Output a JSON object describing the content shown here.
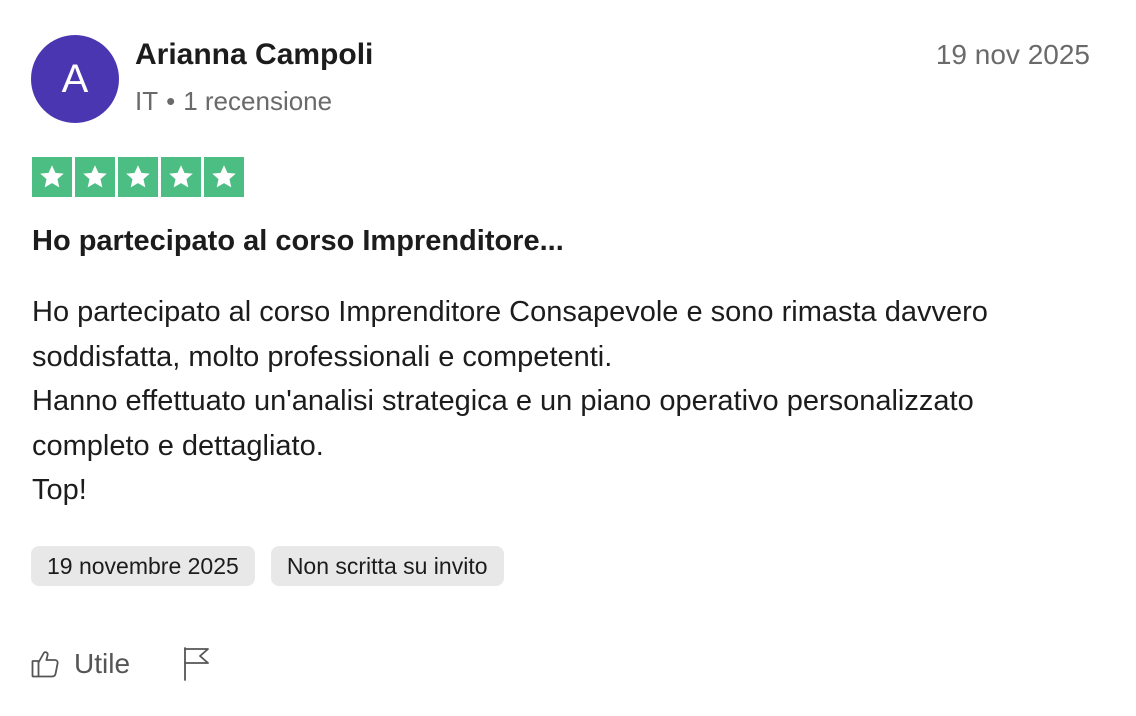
{
  "reviewer": {
    "initial": "A",
    "name": "Arianna Campoli",
    "country": "IT",
    "separator": "•",
    "review_count": "1 recensione",
    "avatar_color": "#4b36b1"
  },
  "review": {
    "date_short": "19 nov 2025",
    "rating": 5,
    "max_rating": 5,
    "star_color": "#4cbe84",
    "title": "Ho partecipato al corso Imprenditore...",
    "body_lines": [
      "Ho partecipato al corso Imprenditore Consapevole e sono rimasta davvero soddisfatta, molto professionali e competenti.",
      "Hanno effettuato un'analisi strategica e un piano operativo personalizzato completo e dettagliato.",
      "Top!"
    ],
    "chips": {
      "date": "19 novembre 2025",
      "invite_status": "Non scritta su invito"
    }
  },
  "actions": {
    "useful_label": "Utile",
    "useful_icon": "thumbs-up-icon",
    "flag_icon": "flag-icon"
  }
}
